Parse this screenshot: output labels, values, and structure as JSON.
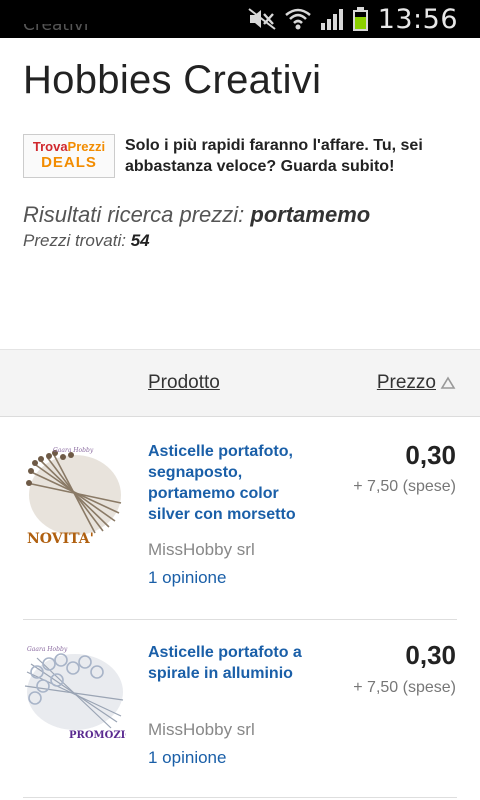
{
  "status_bar": {
    "time": "13:56",
    "icons": [
      "mute-icon",
      "wifi-icon",
      "signal-icon",
      "battery-icon"
    ],
    "battery_color": "#8bd000"
  },
  "breadcrumb": "Creativi",
  "page_title": "Hobbies Creativi",
  "deals": {
    "logo_line1a": "Trova",
    "logo_line1b": "Prezzi",
    "logo_line2": "DEALS",
    "text": "Solo i più rapidi faranno l'affare. Tu, sei abbastanza veloce? Guarda subito!"
  },
  "search": {
    "results_label": "Risultati ricerca prezzi:",
    "query": "portamemo",
    "found_label": "Prezzi trovati:",
    "found_count": "54"
  },
  "table": {
    "col_product": "Prodotto",
    "col_price": "Prezzo",
    "sort_icon": "sort-up-triangle-icon"
  },
  "products": [
    {
      "name": "Asticelle portafoto, segnaposto, portamemo color silver con morsetto",
      "price": "0,30",
      "shipping": "+ 7,50 (spese)",
      "shop": "MissHobby srl",
      "reviews": "1 opinione",
      "badge": "NOVITA'"
    },
    {
      "name": "Asticelle portafoto a spirale in alluminio",
      "price": "0,30",
      "shipping": "+ 7,50 (spese)",
      "shop": "MissHobby srl",
      "reviews": "1 opinione",
      "badge": "PROMOZIONE"
    }
  ],
  "colors": {
    "link": "#1a5fa8",
    "header_bg": "#f4f4f4"
  }
}
